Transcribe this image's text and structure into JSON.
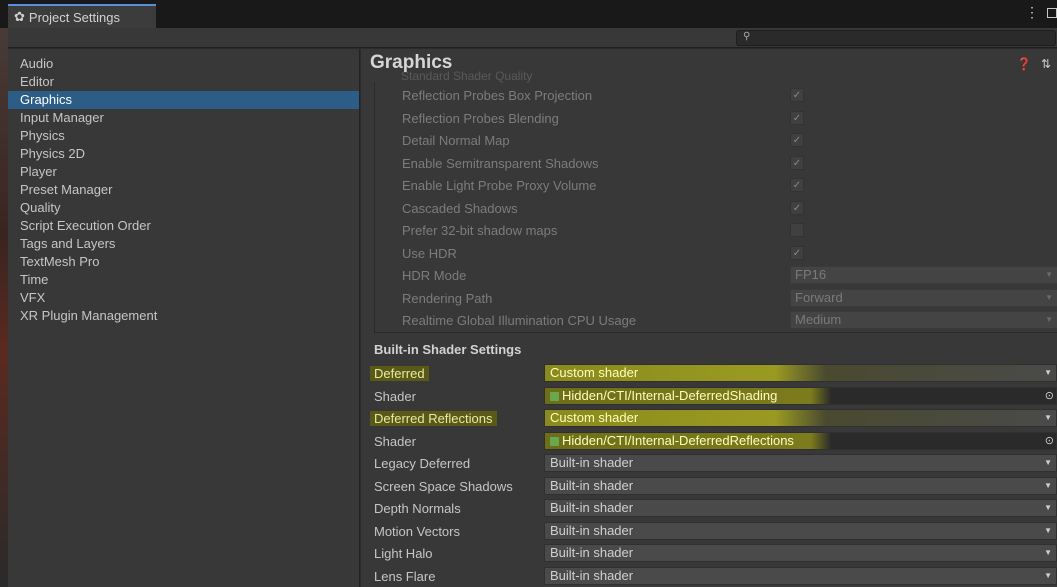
{
  "window": {
    "title": "Project Settings",
    "menu_glyph": "⋮",
    "search": {
      "value": "",
      "placeholder": ""
    }
  },
  "sidebar": {
    "items": [
      {
        "label": "Audio"
      },
      {
        "label": "Editor"
      },
      {
        "label": "Graphics"
      },
      {
        "label": "Input Manager"
      },
      {
        "label": "Physics"
      },
      {
        "label": "Physics 2D"
      },
      {
        "label": "Player"
      },
      {
        "label": "Preset Manager"
      },
      {
        "label": "Quality"
      },
      {
        "label": "Script Execution Order"
      },
      {
        "label": "Tags and Layers"
      },
      {
        "label": "TextMesh Pro"
      },
      {
        "label": "Time"
      },
      {
        "label": "VFX"
      },
      {
        "label": "XR Plugin Management"
      }
    ],
    "selected": "Graphics"
  },
  "main": {
    "title": "Graphics",
    "partial_row": "Standard Shader Quality",
    "tier_settings": [
      {
        "label": "Reflection Probes Box Projection",
        "type": "checkbox",
        "checked": true
      },
      {
        "label": "Reflection Probes Blending",
        "type": "checkbox",
        "checked": true
      },
      {
        "label": "Detail Normal Map",
        "type": "checkbox",
        "checked": true
      },
      {
        "label": "Enable Semitransparent Shadows",
        "type": "checkbox",
        "checked": true
      },
      {
        "label": "Enable Light Probe Proxy Volume",
        "type": "checkbox",
        "checked": true
      },
      {
        "label": "Cascaded Shadows",
        "type": "checkbox",
        "checked": true
      },
      {
        "label": "Prefer 32-bit shadow maps",
        "type": "checkbox",
        "checked": false
      },
      {
        "label": "Use HDR",
        "type": "checkbox",
        "checked": true
      },
      {
        "label": "HDR Mode",
        "type": "dropdown",
        "value": "FP16"
      },
      {
        "label": "Rendering Path",
        "type": "dropdown",
        "value": "Forward"
      },
      {
        "label": "Realtime Global Illumination CPU Usage",
        "type": "dropdown",
        "value": "Medium"
      }
    ],
    "builtin_section_title": "Built-in Shader Settings",
    "builtin_rows": [
      {
        "label": "Deferred",
        "value": "Custom shader",
        "kind": "dropdown",
        "highlight": true
      },
      {
        "label": "Shader",
        "value": "Hidden/CTI/Internal-DeferredShading",
        "kind": "object",
        "highlight": true
      },
      {
        "label": "Deferred Reflections",
        "value": "Custom shader",
        "kind": "dropdown",
        "highlight": true
      },
      {
        "label": "Shader",
        "value": "Hidden/CTI/Internal-DeferredReflections",
        "kind": "object",
        "highlight": true
      },
      {
        "label": "Legacy Deferred",
        "value": "Built-in shader",
        "kind": "dropdown",
        "highlight": false
      },
      {
        "label": "Screen Space Shadows",
        "value": "Built-in shader",
        "kind": "dropdown",
        "highlight": false
      },
      {
        "label": "Depth Normals",
        "value": "Built-in shader",
        "kind": "dropdown",
        "highlight": false
      },
      {
        "label": "Motion Vectors",
        "value": "Built-in shader",
        "kind": "dropdown",
        "highlight": false
      },
      {
        "label": "Light Halo",
        "value": "Built-in shader",
        "kind": "dropdown",
        "highlight": false
      },
      {
        "label": "Lens Flare",
        "value": "Built-in shader",
        "kind": "dropdown",
        "highlight": false
      }
    ]
  },
  "colors": {
    "selection": "#2c5d87",
    "highlighter": "#9a9a22",
    "panel": "#383838"
  },
  "icons": {
    "title": "gear-icon",
    "help": "help-icon",
    "settings": "sliders-icon",
    "search": "search-icon",
    "shader": "shader-icon",
    "object_picker": "target-icon"
  }
}
